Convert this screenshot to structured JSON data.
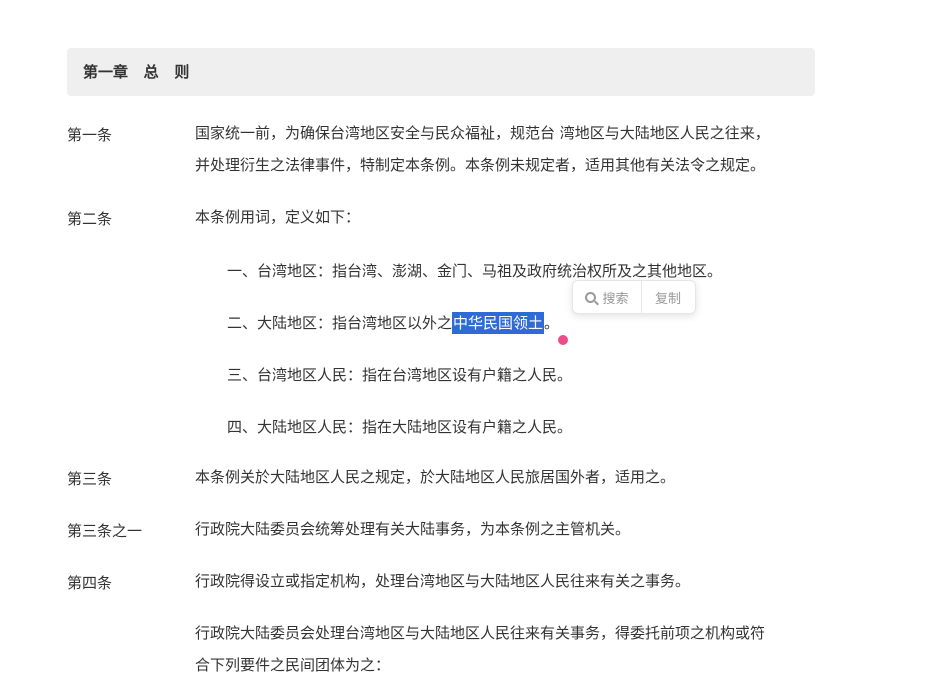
{
  "chapter": {
    "title": "第一章   总   则"
  },
  "articles": [
    {
      "label": "第一条",
      "lines": [
        "国家统一前，为确保台湾地区安全与民众福祉，规范台 湾地区与大陆地区人民之往来，",
        "并处理衍生之法律事件，特制定本条例。本条例未规定者，适用其他有关法令之规定。"
      ]
    },
    {
      "label": "第二条",
      "lines": [
        "本条例用词，定义如下："
      ]
    },
    {
      "label": "第三条",
      "lines": [
        "本条例关於大陆地区人民之规定，於大陆地区人民旅居国外者，适用之。"
      ]
    },
    {
      "label": "第三条之一",
      "lines": [
        "行政院大陆委员会统筹处理有关大陆事务，为本条例之主管机关。"
      ]
    },
    {
      "label": "第四条",
      "lines": [
        "行政院得设立或指定机构，处理台湾地区与大陆地区人民往来有关之事务。"
      ]
    }
  ],
  "definitions": {
    "item1": "一、台湾地区：指台湾、澎湖、金门、马祖及政府统治权所及之其他地区。",
    "item2_prefix": "二、大陆地区：指台湾地区以外之",
    "item2_selected": "中华民国领土",
    "item2_suffix": "。",
    "item3": "三、台湾地区人民：指在台湾地区设有户籍之人民。",
    "item4": "四、大陆地区人民：指在大陆地区设有户籍之人民。"
  },
  "article4_paragraph2": [
    "行政院大陆委员会处理台湾地区与大陆地区人民往来有关事务，得委托前项之机构或符",
    "合下列要件之民间团体为之："
  ],
  "selection_popup": {
    "search_label": "搜索",
    "copy_label": "复制"
  },
  "colors": {
    "selection": "#2f6bd6",
    "handle": "#ec4c8a",
    "chapter_bg": "#efefef"
  }
}
